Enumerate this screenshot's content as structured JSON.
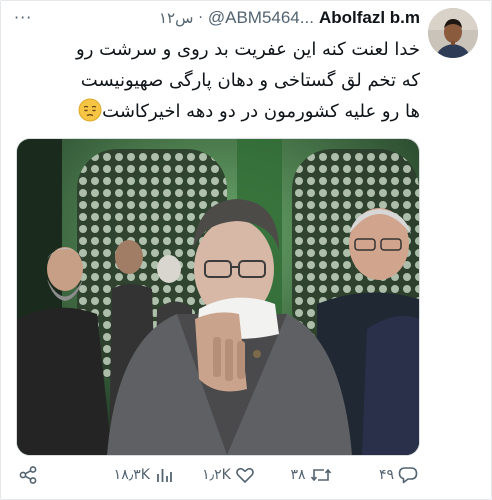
{
  "tweet": {
    "display_name": "Abolfazl b.m",
    "handle": "@ABM5464...",
    "separator": "·",
    "time": "۱۲س",
    "more_label": "···",
    "lines": [
      "خدا لعنت کنه این عفریت بد روی و سرشت رو",
      "که تخم لق گستاخی و دهان پارگی صهیونیست",
      "ها رو علیه کشورمون در دو دهه اخیرکاشت"
    ],
    "emoji": "pensive-face-emoji"
  },
  "actions": {
    "reply_count": "۴۹",
    "retweet_count": "۳۸",
    "like_count": "۱٫۲K",
    "view_count": "۱۸٫۳K"
  },
  "icons": {
    "reply": "reply-icon",
    "retweet": "retweet-icon",
    "like": "heart-icon",
    "views": "views-icon",
    "share": "share-icon"
  },
  "colors": {
    "text": "#0f1419",
    "secondary": "#536471",
    "emoji": "#f6c544"
  }
}
